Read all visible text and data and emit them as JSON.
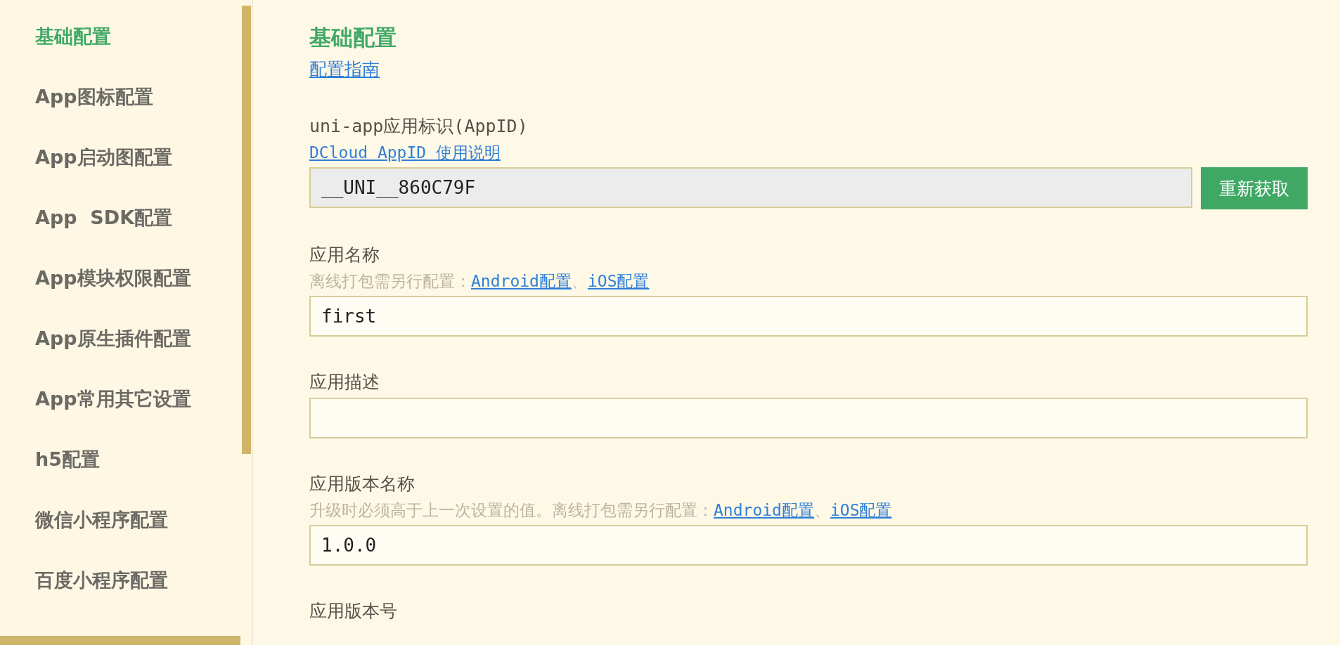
{
  "sidebar": {
    "items": [
      {
        "label": "基础配置",
        "selected": true
      },
      {
        "label": "App图标配置",
        "selected": false
      },
      {
        "label": "App启动图配置",
        "selected": false
      },
      {
        "label": "App  SDK配置",
        "selected": false
      },
      {
        "label": "App模块权限配置",
        "selected": false
      },
      {
        "label": "App原生插件配置",
        "selected": false
      },
      {
        "label": "App常用其它设置",
        "selected": false
      },
      {
        "label": "h5配置",
        "selected": false
      },
      {
        "label": "微信小程序配置",
        "selected": false
      },
      {
        "label": "百度小程序配置",
        "selected": false
      }
    ]
  },
  "main": {
    "title": "基础配置",
    "guide_link": "配置指南",
    "fields": [
      {
        "label": "uni-app应用标识(AppID)",
        "doc_link": "DCloud AppID 使用说明",
        "value": "__UNI__860C79F",
        "readonly": true,
        "button": "重新获取"
      },
      {
        "label": "应用名称",
        "hint": [
          {
            "kind": "text",
            "text": "离线打包需另行配置："
          },
          {
            "kind": "link",
            "text": "Android配置"
          },
          {
            "kind": "text",
            "text": "、"
          },
          {
            "kind": "link",
            "text": "iOS配置"
          }
        ],
        "value": "first",
        "readonly": false
      },
      {
        "label": "应用描述",
        "readonly": false
      },
      {
        "label": "应用版本名称",
        "hint": [
          {
            "kind": "text",
            "text": "升级时必须高于上一次设置的值。离线打包需另行配置："
          },
          {
            "kind": "link",
            "text": "Android配置"
          },
          {
            "kind": "text",
            "text": "、"
          },
          {
            "kind": "link",
            "text": "iOS配置"
          }
        ],
        "value": "1.0.0",
        "readonly": false
      }
    ],
    "next_section_label": "应用版本号"
  }
}
